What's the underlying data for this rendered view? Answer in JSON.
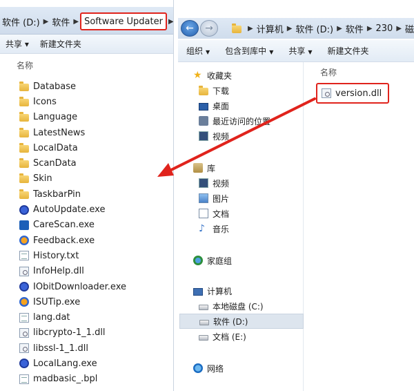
{
  "left_window": {
    "address": [
      "软件 (D:)",
      "软件",
      "Software Updater"
    ],
    "toolbar": [
      "共享 ▾",
      "新建文件夹"
    ],
    "column_header": "名称",
    "files": [
      {
        "name": "Database",
        "icon": "folder-icon"
      },
      {
        "name": "Icons",
        "icon": "folder-icon"
      },
      {
        "name": "Language",
        "icon": "folder-icon"
      },
      {
        "name": "LatestNews",
        "icon": "folder-icon"
      },
      {
        "name": "LocalData",
        "icon": "folder-icon"
      },
      {
        "name": "ScanData",
        "icon": "folder-icon"
      },
      {
        "name": "Skin",
        "icon": "folder-icon"
      },
      {
        "name": "TaskbarPin",
        "icon": "folder-icon"
      },
      {
        "name": "AutoUpdate.exe",
        "icon": "exe-icon"
      },
      {
        "name": "CareScan.exe",
        "icon": "exe-icon"
      },
      {
        "name": "Feedback.exe",
        "icon": "exe-icon"
      },
      {
        "name": "History.txt",
        "icon": "text-file-icon"
      },
      {
        "name": "InfoHelp.dll",
        "icon": "dll-icon"
      },
      {
        "name": "IObitDownloader.exe",
        "icon": "exe-icon"
      },
      {
        "name": "ISUTip.exe",
        "icon": "exe-icon"
      },
      {
        "name": "lang.dat",
        "icon": "file-icon"
      },
      {
        "name": "libcrypto-1_1.dll",
        "icon": "dll-icon"
      },
      {
        "name": "libssl-1_1.dll",
        "icon": "dll-icon"
      },
      {
        "name": "LocalLang.exe",
        "icon": "exe-icon"
      },
      {
        "name": "madbasic_.bpl",
        "icon": "file-icon"
      }
    ]
  },
  "right_window": {
    "address": [
      "计算机",
      "软件 (D:)",
      "软件",
      "230",
      "磁"
    ],
    "toolbar": [
      "组织",
      "包含到库中",
      "共享",
      "新建文件夹"
    ],
    "nav": {
      "favorites": "收藏夹",
      "downloads": "下载",
      "desktop": "桌面",
      "recent": "最近访问的位置",
      "videos_fav": "视频",
      "libraries": "库",
      "lib_videos": "视频",
      "lib_pictures": "图片",
      "lib_documents": "文档",
      "lib_music": "音乐",
      "homegroup": "家庭组",
      "computer": "计算机",
      "drive_c": "本地磁盘 (C:)",
      "drive_d": "软件 (D:)",
      "drive_e": "文档 (E:)",
      "network": "网络"
    },
    "column_header": "名称",
    "file": "version.dll"
  },
  "colors": {
    "highlight_red": "#e0231c"
  }
}
